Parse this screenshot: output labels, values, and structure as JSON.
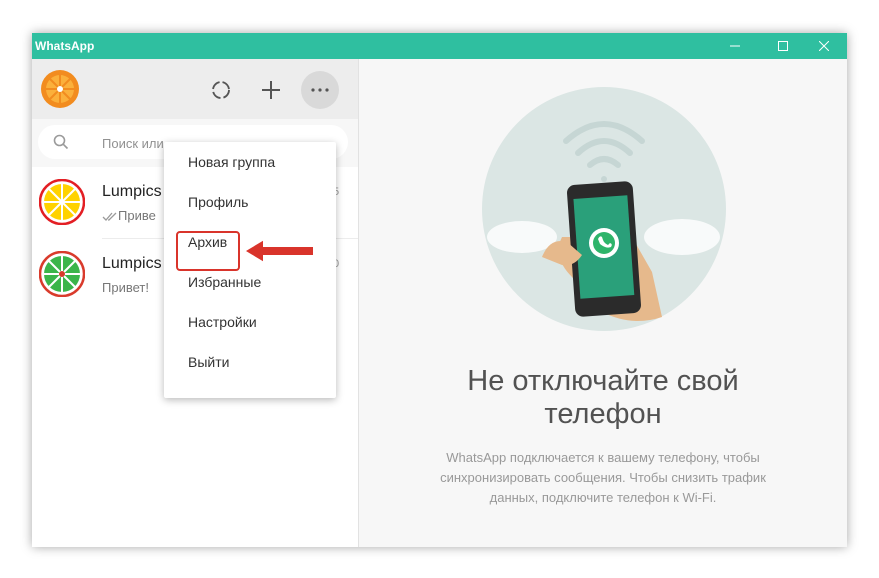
{
  "window": {
    "title": "WhatsApp"
  },
  "header": {
    "status_icon": "status-icon",
    "new_chat_icon": "plus-icon",
    "menu_icon": "more-icon"
  },
  "search": {
    "placeholder": "Поиск или"
  },
  "chats": [
    {
      "name": "Lumpics",
      "preview": "Приве",
      "time": "5",
      "read_receipt": "double-check"
    },
    {
      "name": "Lumpics",
      "preview": "Привет!",
      "time": "0"
    }
  ],
  "menu": {
    "items": [
      "Новая группа",
      "Профиль",
      "Архив",
      "Избранные",
      "Настройки",
      "Выйти"
    ],
    "highlighted": "Архив"
  },
  "intro": {
    "title_line1": "Не отключайте свой",
    "title_line2": "телефон",
    "desc_line1": "WhatsApp подключается к вашему телефону, чтобы",
    "desc_line2": "синхронизировать сообщения. Чтобы снизить трафик",
    "desc_line3": "данных, подключите телефон к Wi-Fi."
  },
  "colors": {
    "titlebar": "#2fbfa0",
    "accent": "#d9342b",
    "whatsapp_green": "#2eb46a"
  }
}
